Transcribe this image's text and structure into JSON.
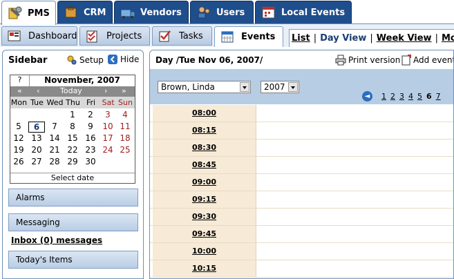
{
  "top_tabs": [
    "PMS",
    "CRM",
    "Vendors",
    "Users",
    "Local Events"
  ],
  "sub_tabs": [
    "Dashboard",
    "Projects",
    "Tasks",
    "Events"
  ],
  "view_links": {
    "list": "List",
    "day": "Day View",
    "week": "Week View",
    "month": "Month"
  },
  "sidebar": {
    "title": "Sidebar",
    "setup": "Setup",
    "hide": "Hide",
    "calendar": {
      "help": "?",
      "month": "November, 2007",
      "nav": [
        "«",
        "‹",
        "Today",
        "›",
        "»"
      ],
      "weekdays": [
        "Mon",
        "Tue",
        "Wed",
        "Thu",
        "Fri",
        "Sat",
        "Sun"
      ],
      "weeks": [
        [
          "",
          "",
          "",
          "1",
          "2",
          "3",
          "4"
        ],
        [
          "5",
          "6",
          "7",
          "8",
          "9",
          "10",
          "11"
        ],
        [
          "12",
          "13",
          "14",
          "15",
          "16",
          "17",
          "18"
        ],
        [
          "19",
          "20",
          "21",
          "22",
          "23",
          "24",
          "25"
        ],
        [
          "26",
          "27",
          "28",
          "29",
          "30",
          "",
          ""
        ]
      ],
      "selected_day": "6",
      "select_date": "Select date"
    },
    "alarms": "Alarms",
    "messaging": "Messaging",
    "inbox": "Inbox (0) messages",
    "todays_items": "Today's Items"
  },
  "main": {
    "title": "Day /Tue Nov 06, 2007/",
    "print_version": "Print version",
    "add_event": "Add event",
    "user_select": "Brown, Linda",
    "year_select": "2007",
    "day_links": [
      "1",
      "2",
      "3",
      "4",
      "5",
      "6",
      "7"
    ],
    "current_day": "6",
    "time_slots": [
      "08:00",
      "08:15",
      "08:30",
      "08:45",
      "09:00",
      "09:15",
      "09:30",
      "09:45",
      "10:00",
      "10:15"
    ]
  },
  "colors": {
    "tab_blue": "#1f4e8c",
    "filter_bg": "#b7cde4",
    "slot_bg": "#f7ead6",
    "weekend_red": "#a02020"
  }
}
